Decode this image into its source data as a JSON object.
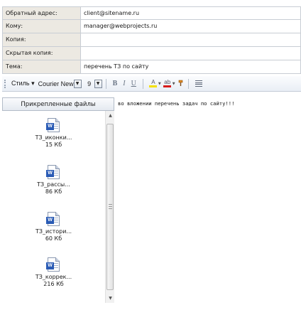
{
  "fields": [
    {
      "label": "Обратный адрес:",
      "value": "client@sitename.ru"
    },
    {
      "label": "Кому:",
      "value": "manager@webprojects.ru"
    },
    {
      "label": "Копия:",
      "value": ""
    },
    {
      "label": "Скрытая копия:",
      "value": ""
    },
    {
      "label": "Тема:",
      "value": "перечень ТЗ по сайту"
    }
  ],
  "toolbar": {
    "style_label": "Стиль ▾",
    "font_name": "Courier New",
    "font_size": "9",
    "bold": "B",
    "italic": "I",
    "underline": "U",
    "highlight_color": "#f4e000",
    "font_color": "#d61a1a",
    "icons": [
      "grip-icon",
      "dropdown-icon",
      "bold-icon",
      "italic-icon",
      "underline-icon",
      "font-color-icon",
      "highlight-color-icon",
      "format-painter-icon",
      "align-left-icon"
    ]
  },
  "attachments": {
    "header": "Прикрепленные файлы",
    "items": [
      {
        "name": "ТЗ_иконки...",
        "size": "15 Кб",
        "icon": "word-doc-icon"
      },
      {
        "name": "ТЗ_рассы...",
        "size": "86 Кб",
        "icon": "word-doc-icon"
      },
      {
        "name": "ТЗ_истори...",
        "size": "60 Кб",
        "icon": "word-doc-icon"
      },
      {
        "name": "ТЗ_коррек...",
        "size": "216 Кб",
        "icon": "word-doc-icon"
      }
    ]
  },
  "body": {
    "text": "во вложении перечень задач по сайту!!!"
  }
}
